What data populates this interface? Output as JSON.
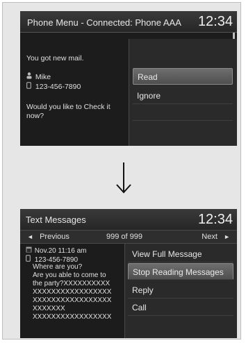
{
  "screen1": {
    "header": {
      "title": "Phone Menu - Connected: Phone AAA",
      "clock": "12:34"
    },
    "message": {
      "notice": "You got new mail.",
      "sender_name": "Mike",
      "sender_number": "123-456-7890",
      "prompt_line1": "Would you like to Check it",
      "prompt_line2": "now?"
    },
    "menu": {
      "read_label": "Read",
      "ignore_label": "Ignore"
    }
  },
  "screen2": {
    "header": {
      "title": "Text Messages",
      "clock": "12:34"
    },
    "nav": {
      "previous_label": "Previous",
      "counter": "999 of 999",
      "next_label": "Next"
    },
    "message": {
      "date": "Nov.20 11:16 am",
      "number": "123-456-7890",
      "body_lines": [
        "Where are you?",
        "Are you able to come to",
        "the party?XXXXXXXXXX",
        "XXXXXXXXXXXXXXXXX",
        "XXXXXXXXXXXXXXXXX",
        "XXXXXXX",
        "XXXXXXXXXXXXXXXXX"
      ]
    },
    "menu": [
      {
        "label": "View Full Message"
      },
      {
        "label": "Stop Reading Messages"
      },
      {
        "label": "Reply"
      },
      {
        "label": "Call"
      }
    ]
  },
  "icons": {
    "person": "person-icon",
    "phone": "phone-icon",
    "calendar": "calendar-icon",
    "arrow": "down-arrow-icon"
  },
  "colors": {
    "screen_bg": "#1c1c1c",
    "selected_bg": "#5e5e5e",
    "text": "#e8e8e8"
  }
}
